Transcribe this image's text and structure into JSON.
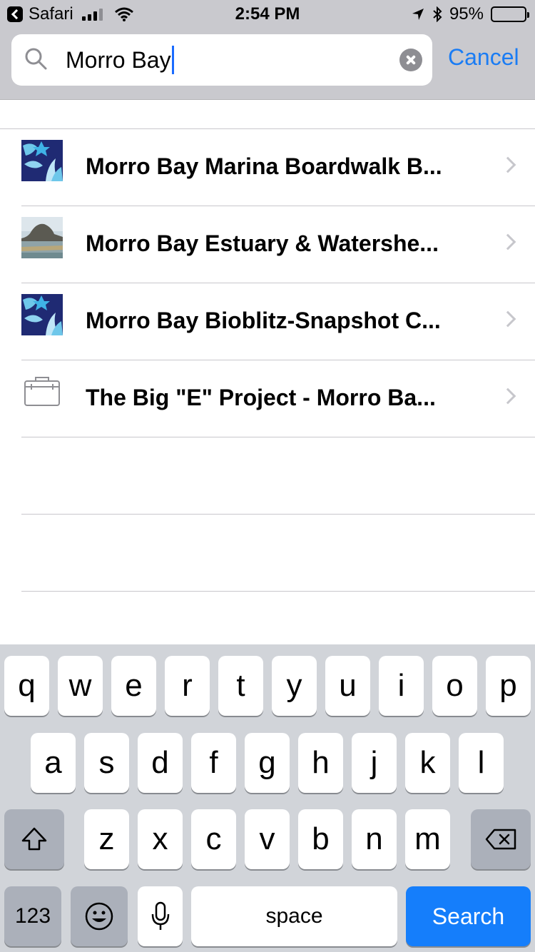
{
  "status_bar": {
    "back_app": "Safari",
    "time": "2:54 PM",
    "battery": "95%",
    "battery_level": 0.95
  },
  "search": {
    "query": "Morro Bay",
    "cancel_label": "Cancel"
  },
  "results": [
    {
      "title": "Morro Bay Marina Boardwalk B...",
      "thumb": "sea-life-logo"
    },
    {
      "title": "Morro Bay Estuary & Watershe...",
      "thumb": "morro-rock-photo"
    },
    {
      "title": "Morro Bay Bioblitz-Snapshot C...",
      "thumb": "sea-life-logo"
    },
    {
      "title": "The Big \"E\" Project - Morro Ba...",
      "thumb": "briefcase-icon"
    }
  ],
  "keyboard": {
    "row1": [
      "q",
      "w",
      "e",
      "r",
      "t",
      "y",
      "u",
      "i",
      "o",
      "p"
    ],
    "row2": [
      "a",
      "s",
      "d",
      "f",
      "g",
      "h",
      "j",
      "k",
      "l"
    ],
    "row3": [
      "z",
      "x",
      "c",
      "v",
      "b",
      "n",
      "m"
    ],
    "numbers_label": "123",
    "space_label": "space",
    "search_label": "Search"
  },
  "colors": {
    "accent": "#1a7cf4",
    "search_key": "#157efb",
    "header_bg": "#c9c9ce",
    "keyboard_bg": "#d1d4d9"
  }
}
